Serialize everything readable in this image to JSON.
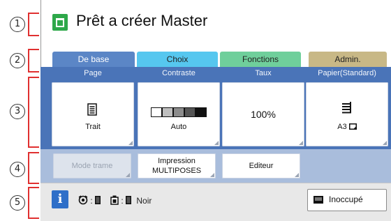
{
  "callouts": [
    "1",
    "2",
    "3",
    "4",
    "5"
  ],
  "title": "Prêt a créer Master",
  "tabs": [
    {
      "label": "De base",
      "color": "#5b86c6"
    },
    {
      "label": "Choix",
      "color": "#56c7ef"
    },
    {
      "label": "Fonctions",
      "color": "#6fcf9b"
    },
    {
      "label": "Admin.",
      "color": "#c8b886"
    }
  ],
  "settings": {
    "page": {
      "label": "Page",
      "value": "Trait",
      "icon": "document-icon"
    },
    "contrast": {
      "label": "Contraste",
      "value": "Auto",
      "level": 5,
      "levels": 5
    },
    "rate": {
      "label": "Taux",
      "value": "100%"
    },
    "paper": {
      "label": "Papier(Standard)",
      "value": "A3",
      "icon": "paper-size-icon"
    }
  },
  "actions": {
    "mode_trame": "Mode trame",
    "multi_line1": "Impression",
    "multi_line2": "MULTIPOSES",
    "editor": "Editeur"
  },
  "status": {
    "info": "i",
    "ink_sep": ":",
    "drum_sep": ":",
    "drum_color": "Noir",
    "idle": "Inoccupé"
  },
  "colors": {
    "accent": "#e03030",
    "panel": "#4a74b8",
    "panel_light": "#a9bddc"
  }
}
